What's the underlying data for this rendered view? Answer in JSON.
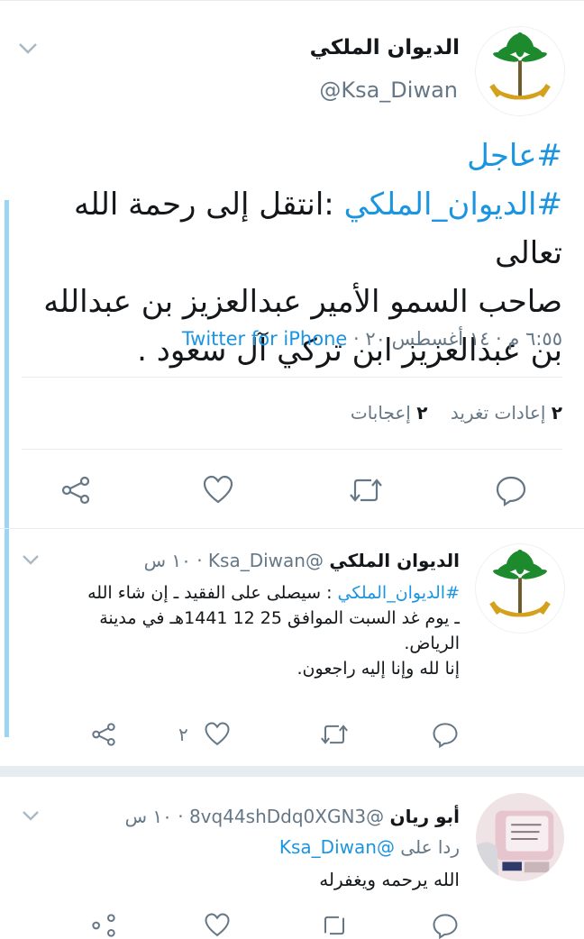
{
  "main_tweet": {
    "display_name": "الديوان الملكي",
    "handle": "@Ksa_Diwan",
    "hashtag_urgent": "#عاجل",
    "hashtag_diwan": "#الديوان_الملكي",
    "line1_rest": " :انتقل إلى رحمة الله تعالى",
    "line2": "صاحب السمو الأمير عبدالعزيز بن عبدالله",
    "line3": "بن عبدالعزيز ابن تركي آل سعود .",
    "timestamp": "٦:٥٥ م · ١٤ أغسطس ٢٠ · ",
    "client": "Twitter for iPhone",
    "retweets_count": "٢",
    "retweets_label": "إعادات تغريد",
    "likes_count": "٢",
    "likes_label": "إعجابات"
  },
  "reply1": {
    "display_name": "الديوان الملكي",
    "handle": "@Ksa_Diwan",
    "time": " · ١٠ س",
    "hashtag": "#الديوان_الملكي",
    "line1_rest": " : سيصلى على الفقيد ـ إن شاء الله",
    "line2": "ـ يوم غد السبت الموافق 25 12 1441هـ في مدينة",
    "line3": "الرياض.",
    "line4": "إنا لله وإنا إليه راجعون.",
    "like_count": "٢"
  },
  "reply2": {
    "display_name": "أبو ريان",
    "handle": "@8vq44shDdq0XGN3",
    "time": " · ١٠ س",
    "replying_to_label": "ردا على",
    "replying_to_handle": "@Ksa_Diwan",
    "text": "الله يرحمه ويغفرله"
  },
  "colors": {
    "accent": "#1b95e0",
    "thread_line": "#9dd4f4",
    "muted": "#657786",
    "palm_green": "#1e8a2e",
    "sword_gold": "#d4a11c"
  },
  "icons": [
    "chevron-down-icon",
    "share-icon",
    "heart-icon",
    "retweet-icon",
    "reply-icon",
    "palm-swords-logo"
  ]
}
